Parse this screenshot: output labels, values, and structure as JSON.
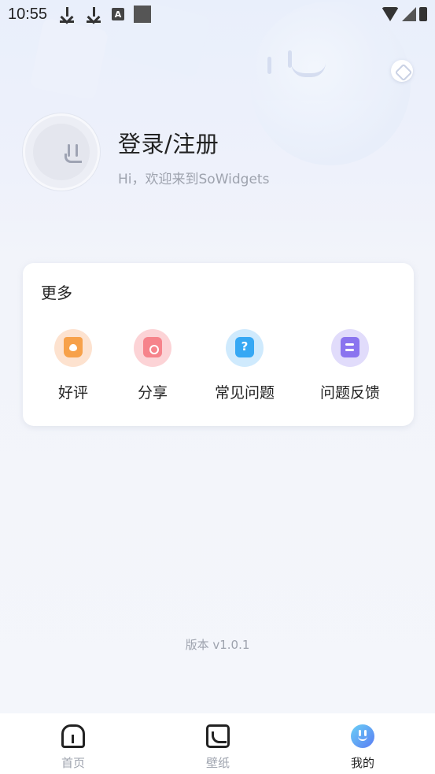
{
  "status_bar": {
    "time": "10:55",
    "left_icons": [
      "download-icon",
      "download-icon",
      "a-notification-icon",
      "square-notification-icon"
    ],
    "right_icons": [
      "wifi-icon",
      "signal-icon",
      "battery-icon"
    ],
    "a_icon_text": "A"
  },
  "profile": {
    "title": "登录/注册",
    "subtitle": "Hi，欢迎来到SoWidgets"
  },
  "more_section": {
    "title": "更多",
    "items": [
      {
        "label": "好评",
        "icon": "thumbs-up-icon",
        "color": "#f7a14a"
      },
      {
        "label": "分享",
        "icon": "share-icon",
        "color": "#f6838b"
      },
      {
        "label": "常见问题",
        "icon": "question-icon",
        "color": "#36a8f4",
        "glyph": "?"
      },
      {
        "label": "问题反馈",
        "icon": "feedback-icon",
        "color": "#8a74ef"
      }
    ]
  },
  "version": "版本 v1.0.1",
  "bottom_nav": {
    "items": [
      {
        "label": "首页",
        "icon": "home-icon",
        "active": false
      },
      {
        "label": "壁纸",
        "icon": "wallpaper-icon",
        "active": false
      },
      {
        "label": "我的",
        "icon": "smiley-profile-icon",
        "active": true
      }
    ],
    "active_color": "#222222",
    "inactive_color": "#9ea3ae"
  }
}
